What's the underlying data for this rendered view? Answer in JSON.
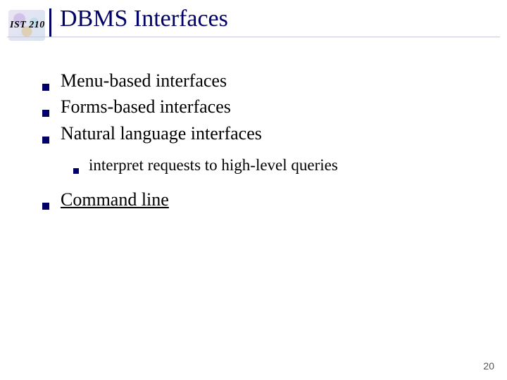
{
  "course": "IST 210",
  "title": "DBMS Interfaces",
  "bullets": [
    {
      "text": "Menu-based interfaces",
      "underline": false
    },
    {
      "text": "Forms-based interfaces",
      "underline": false
    },
    {
      "text": "Natural language interfaces",
      "underline": false
    }
  ],
  "sub_bullet": "interpret requests to high-level queries",
  "last_bullet": {
    "text": "Command line",
    "underline": true
  },
  "page_number": "20"
}
